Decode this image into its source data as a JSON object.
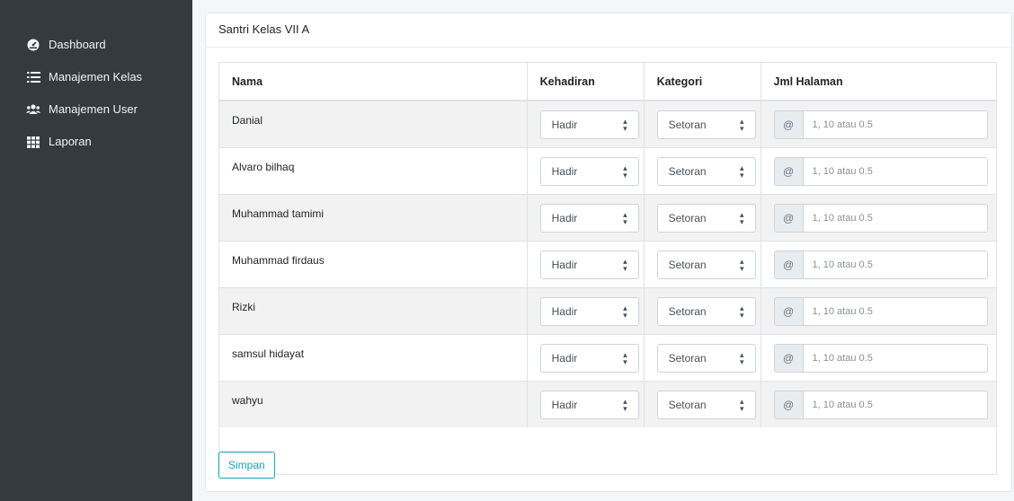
{
  "sidebar": {
    "items": [
      {
        "label": "Dashboard",
        "icon": "tachometer-icon"
      },
      {
        "label": "Manajemen Kelas",
        "icon": "list-icon"
      },
      {
        "label": "Manajemen User",
        "icon": "users-icon"
      },
      {
        "label": "Laporan",
        "icon": "grid-icon"
      }
    ]
  },
  "card": {
    "title": "Santri Kelas VII A",
    "columns": [
      "Nama",
      "Kehadiran",
      "Kategori",
      "Jml Halaman"
    ],
    "rows": [
      {
        "name": "Danial",
        "kehadiran": "Hadir",
        "kategori": "Setoran",
        "addon": "@",
        "placeholder": "1, 10 atau 0.5"
      },
      {
        "name": "Alvaro bilhaq",
        "kehadiran": "Hadir",
        "kategori": "Setoran",
        "addon": "@",
        "placeholder": "1, 10 atau 0.5"
      },
      {
        "name": "Muhammad tamimi",
        "kehadiran": "Hadir",
        "kategori": "Setoran",
        "addon": "@",
        "placeholder": "1, 10 atau 0.5"
      },
      {
        "name": "Muhammad firdaus",
        "kehadiran": "Hadir",
        "kategori": "Setoran",
        "addon": "@",
        "placeholder": "1, 10 atau 0.5"
      },
      {
        "name": "Rizki",
        "kehadiran": "Hadir",
        "kategori": "Setoran",
        "addon": "@",
        "placeholder": "1, 10 atau 0.5"
      },
      {
        "name": "samsul hidayat",
        "kehadiran": "Hadir",
        "kategori": "Setoran",
        "addon": "@",
        "placeholder": "1, 10 atau 0.5"
      },
      {
        "name": "wahyu",
        "kehadiran": "Hadir",
        "kategori": "Setoran",
        "addon": "@",
        "placeholder": "1, 10 atau 0.5"
      }
    ],
    "save_label": "Simpan"
  },
  "colors": {
    "sidebar_bg": "#343a40",
    "accent": "#17a2b8",
    "stripe": "#f2f2f2"
  }
}
